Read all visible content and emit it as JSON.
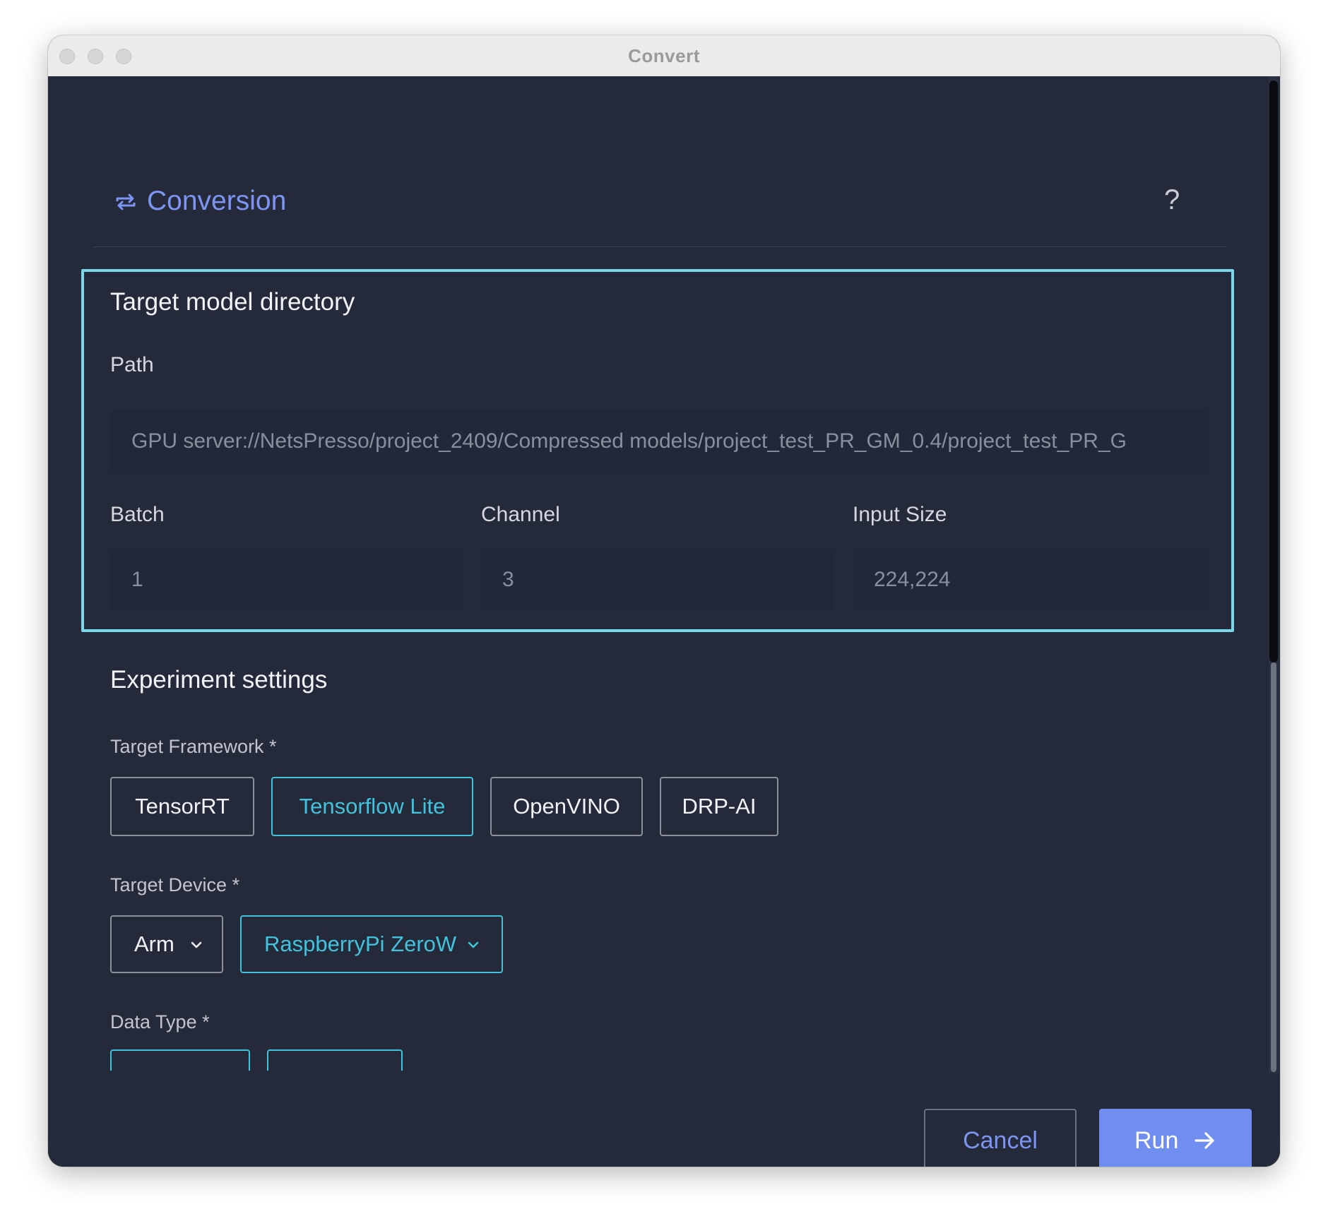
{
  "window": {
    "title": "Convert"
  },
  "header": {
    "title": "Conversion",
    "help_label": "?",
    "icon": "repeat-icon"
  },
  "target_model": {
    "title": "Target model directory",
    "path_label": "Path",
    "path_value": "GPU server://NetsPresso/project_2409/Compressed models/project_test_PR_GM_0.4/project_test_PR_G",
    "batch_label": "Batch",
    "batch_value": "1",
    "channel_label": "Channel",
    "channel_value": "3",
    "input_size_label": "Input Size",
    "input_size_value": "224,224"
  },
  "experiment": {
    "title": "Experiment settings",
    "framework_label": "Target Framework *",
    "frameworks": [
      "TensorRT",
      "Tensorflow Lite",
      "OpenVINO",
      "DRP-AI"
    ],
    "selected_framework": "Tensorflow Lite",
    "device_label": "Target Device *",
    "device_arch": "Arm",
    "device_model": "RaspberryPi ZeroW",
    "data_type_label": "Data Type *"
  },
  "footer": {
    "cancel_label": "Cancel",
    "run_label": "Run"
  },
  "colors": {
    "background": "#252a3a",
    "accent_cyan": "#43c2dc",
    "accent_blue": "#6f8ef0",
    "highlight_border": "#76d8ea"
  }
}
